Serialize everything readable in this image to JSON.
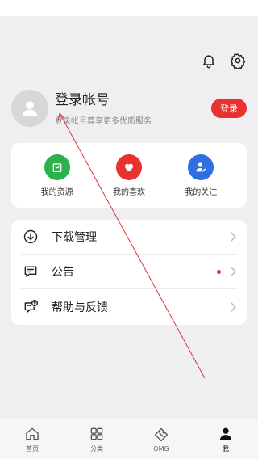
{
  "profile": {
    "name": "登录帐号",
    "subtitle": "登录帐号尊享更多优质服务",
    "login_label": "登录"
  },
  "quick_actions": [
    {
      "label": "我的资源",
      "color": "#2bb24c",
      "icon": "shopping-bag-icon"
    },
    {
      "label": "我的喜欢",
      "color": "#e8322f",
      "icon": "heart-icon"
    },
    {
      "label": "我的关注",
      "color": "#2f6fe0",
      "icon": "user-follow-icon"
    }
  ],
  "menu": [
    {
      "label": "下载管理",
      "icon": "download-icon",
      "dot": false
    },
    {
      "label": "公告",
      "icon": "message-icon",
      "dot": true
    },
    {
      "label": "帮助与反馈",
      "icon": "help-feedback-icon",
      "dot": false
    }
  ],
  "tabs": [
    {
      "label": "首页",
      "icon": "home-icon",
      "active": false
    },
    {
      "label": "分类",
      "icon": "grid-icon",
      "active": false
    },
    {
      "label": "OMG",
      "icon": "omg-icon",
      "active": false
    },
    {
      "label": "我",
      "icon": "person-icon",
      "active": true
    }
  ],
  "colors": {
    "accent_red": "#e8322f",
    "background": "#efeff1"
  }
}
